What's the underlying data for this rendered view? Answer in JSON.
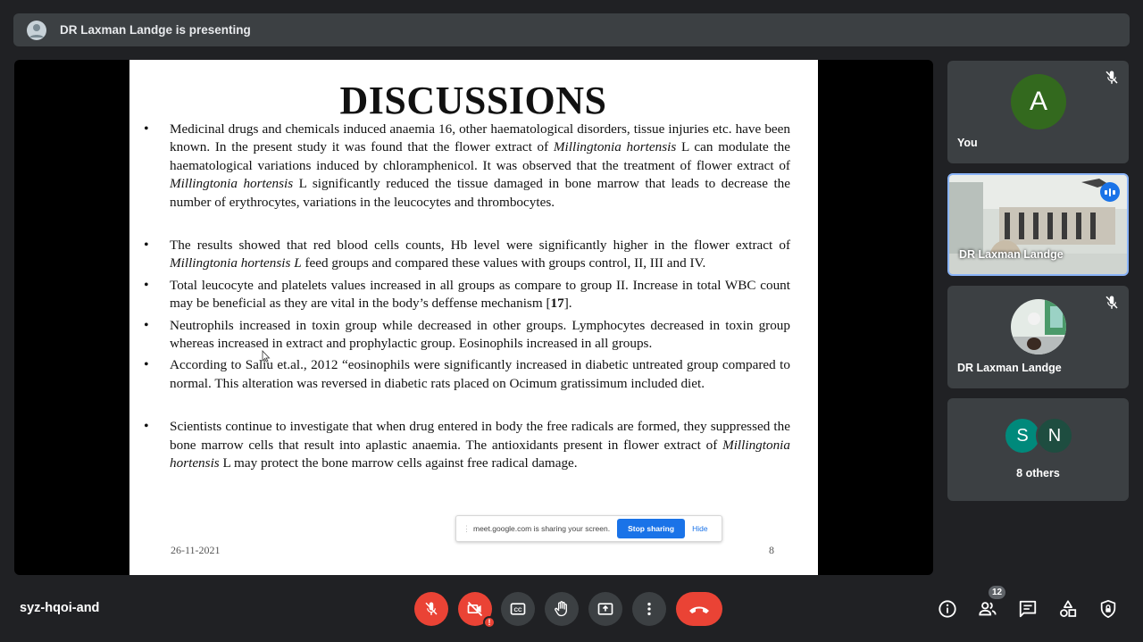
{
  "banner": {
    "presenting_text": "DR Laxman Landge is presenting"
  },
  "slide": {
    "title": "DISCUSSIONS",
    "bullets": [
      {
        "parts": [
          {
            "t": "Medicinal drugs and chemicals induced anaemia 16, other haematological disorders, tissue injuries etc. have been known. In the present study it was found that the flower extract of "
          },
          {
            "i": "Millingtonia hortensis"
          },
          {
            "t": " L can modulate the haematological variations induced by chloramphenicol. It was observed that the treatment of flower extract of "
          },
          {
            "i": "Millingtonia hortensis"
          },
          {
            "t": " L significantly reduced the tissue damaged in bone marrow that leads to decrease the number of erythrocytes, variations in the leucocytes and thrombocytes."
          }
        ]
      },
      {
        "parts": [
          {
            "t": "The results showed that red blood cells counts, Hb level were significantly higher in the flower extract of "
          },
          {
            "i": "Millingtonia hortensis L"
          },
          {
            "t": " feed groups and compared these values with groups control, II, III and IV."
          }
        ]
      },
      {
        "parts": [
          {
            "t": "Total leucocyte and platelets values increased in all groups as compare to group II. Increase in total WBC count may be beneficial as they are vital in the body’s deffense mechanism ["
          },
          {
            "b": "17"
          },
          {
            "t": "]."
          }
        ]
      },
      {
        "parts": [
          {
            "t": "Neutrophils increased in toxin group while decreased in other groups. Lymphocytes decreased in toxin group whereas increased in extract and prophylactic group. Eosinophils increased in all groups."
          }
        ]
      },
      {
        "parts": [
          {
            "t": "According to Saliu et.al., 2012 “eosinophils were significantly increased in diabetic untreated group compared to normal. This alteration was reversed in diabetic rats placed on Ocimum gratissimum included diet."
          }
        ]
      },
      {
        "parts": [
          {
            "t": "Scientists continue to investigate that when drug entered in body the free radicals are formed, they suppressed the bone marrow cells that result into aplastic anaemia. The antioxidants present in flower extract of "
          },
          {
            "i": "Millingtonia hortensis"
          },
          {
            "t": " L may protect the bone marrow cells against free radical damage."
          }
        ]
      }
    ],
    "footer_date": "26-11-2021",
    "footer_page": "8"
  },
  "share_toast": {
    "message": "meet.google.com is sharing your screen.",
    "stop_label": "Stop sharing",
    "hide_label": "Hide"
  },
  "participants": {
    "you": {
      "initial": "A",
      "name": "You",
      "avatar_color": "#33691e"
    },
    "presenter_video": {
      "name": "DR Laxman Landge"
    },
    "presenter_tile": {
      "name": "DR Laxman Landge"
    },
    "others": {
      "initials": [
        "S",
        "N"
      ],
      "colors": [
        "#00897b",
        "#1e4d40"
      ],
      "label": "8 others"
    }
  },
  "bottom_bar": {
    "meeting_code": "syz-hqoi-and",
    "people_count": "12",
    "end_call_color": "#ea4335"
  }
}
